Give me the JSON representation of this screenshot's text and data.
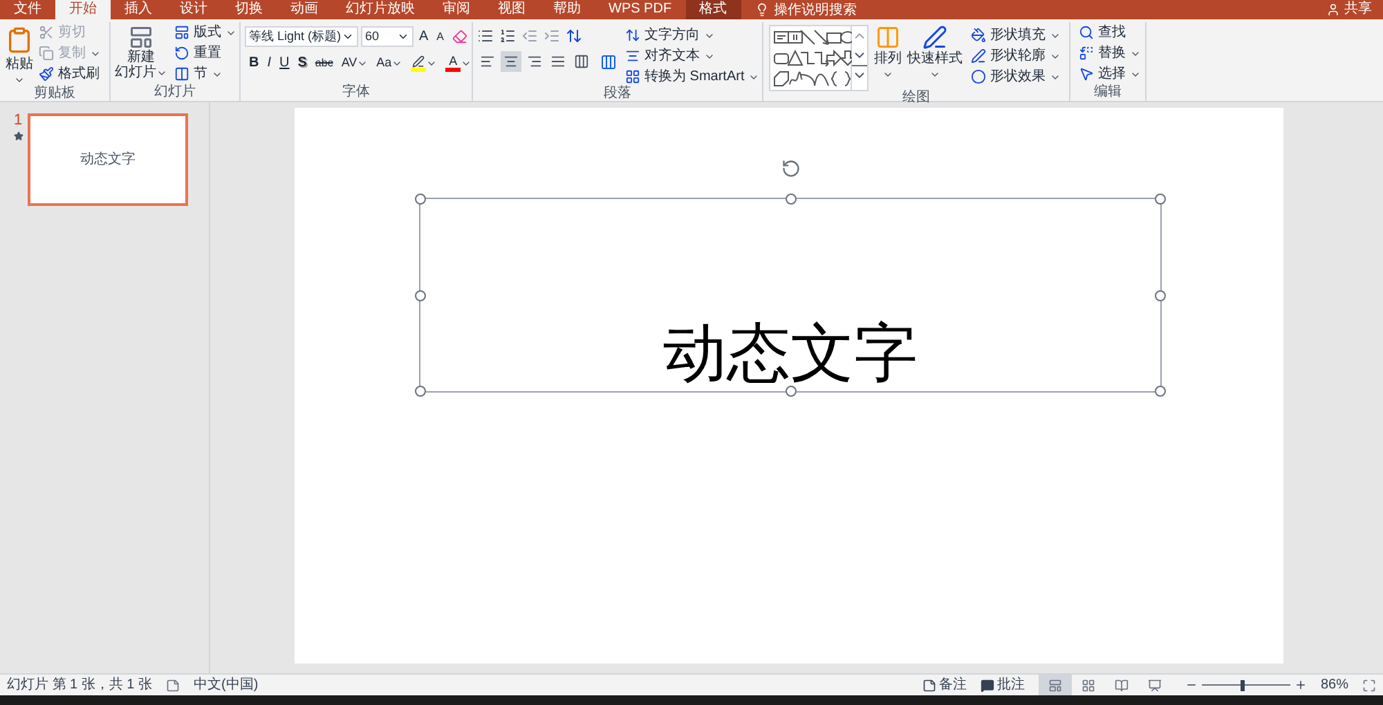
{
  "tabs": [
    {
      "label": "文件",
      "selected": false,
      "kind": "normal"
    },
    {
      "label": "开始",
      "selected": true,
      "kind": "normal"
    },
    {
      "label": "插入",
      "selected": false,
      "kind": "normal"
    },
    {
      "label": "设计",
      "selected": false,
      "kind": "normal"
    },
    {
      "label": "切换",
      "selected": false,
      "kind": "normal"
    },
    {
      "label": "动画",
      "selected": false,
      "kind": "normal"
    },
    {
      "label": "幻灯片放映",
      "selected": false,
      "kind": "normal"
    },
    {
      "label": "审阅",
      "selected": false,
      "kind": "normal"
    },
    {
      "label": "视图",
      "selected": false,
      "kind": "normal"
    },
    {
      "label": "帮助",
      "selected": false,
      "kind": "normal"
    },
    {
      "label": "WPS PDF",
      "selected": false,
      "kind": "normal"
    },
    {
      "label": "格式",
      "selected": false,
      "kind": "contextual"
    }
  ],
  "search": {
    "placeholder": "操作说明搜索"
  },
  "share": "共享",
  "clipboard": {
    "title": "剪贴板",
    "paste": "粘贴",
    "cut": {
      "label": "剪切",
      "disabled": true
    },
    "copy": {
      "label": "复制",
      "disabled": true
    },
    "format_painter": "格式刷"
  },
  "slides_group": {
    "title": "幻灯片",
    "new_slide_1": "新建",
    "new_slide_2": "幻灯片",
    "layout": "版式",
    "reset": "重置",
    "section": "节"
  },
  "font": {
    "title": "字体",
    "font_name": "等线 Light (标题)",
    "font_size": "60",
    "grow": "A",
    "shrink": "A",
    "buttons": [
      {
        "kind": "bold",
        "label": "B"
      },
      {
        "kind": "italic",
        "label": "I"
      },
      {
        "kind": "underline",
        "label": "U"
      },
      {
        "kind": "shadow",
        "label": "S"
      },
      {
        "kind": "strike",
        "label": "abc"
      },
      {
        "kind": "spacing",
        "label": "AV"
      },
      {
        "kind": "case",
        "label": "Aa"
      },
      {
        "kind": "highlight",
        "color": "#ffff00"
      },
      {
        "kind": "fontcolor",
        "label": "A",
        "color": "#ff0000"
      }
    ]
  },
  "paragraph": {
    "title": "段落",
    "text_direction": "文字方向",
    "align_text": "对齐文本",
    "smartart": "转换为 SmartArt",
    "alignment": [
      {
        "kind": "left",
        "selected": false
      },
      {
        "kind": "center",
        "selected": true
      },
      {
        "kind": "right",
        "selected": false
      },
      {
        "kind": "justify",
        "selected": false
      },
      {
        "kind": "distributed",
        "selected": false
      }
    ]
  },
  "drawing": {
    "title": "绘图",
    "arrange": "排列",
    "quick_styles": "快速样式",
    "fill": "形状填充",
    "outline": "形状轮廓",
    "effects": "形状效果"
  },
  "editing": {
    "title": "编辑",
    "find": "查找",
    "replace": "替换",
    "select": "选择"
  },
  "thumbnails": [
    {
      "number": "1",
      "text": "动态文字",
      "selected": true
    }
  ],
  "slide": {
    "text": "动态文字",
    "selected": true
  },
  "status": {
    "slide_info": "幻灯片 第 1 张，共 1 张",
    "language": "中文(中国)",
    "notes": "备注",
    "comments": "批注",
    "views": [
      {
        "kind": "normal",
        "selected": true
      },
      {
        "kind": "sorter",
        "selected": false
      },
      {
        "kind": "reading",
        "selected": false
      },
      {
        "kind": "show",
        "selected": false
      }
    ],
    "zoom": {
      "level": 0.45,
      "reading": "86%"
    }
  }
}
